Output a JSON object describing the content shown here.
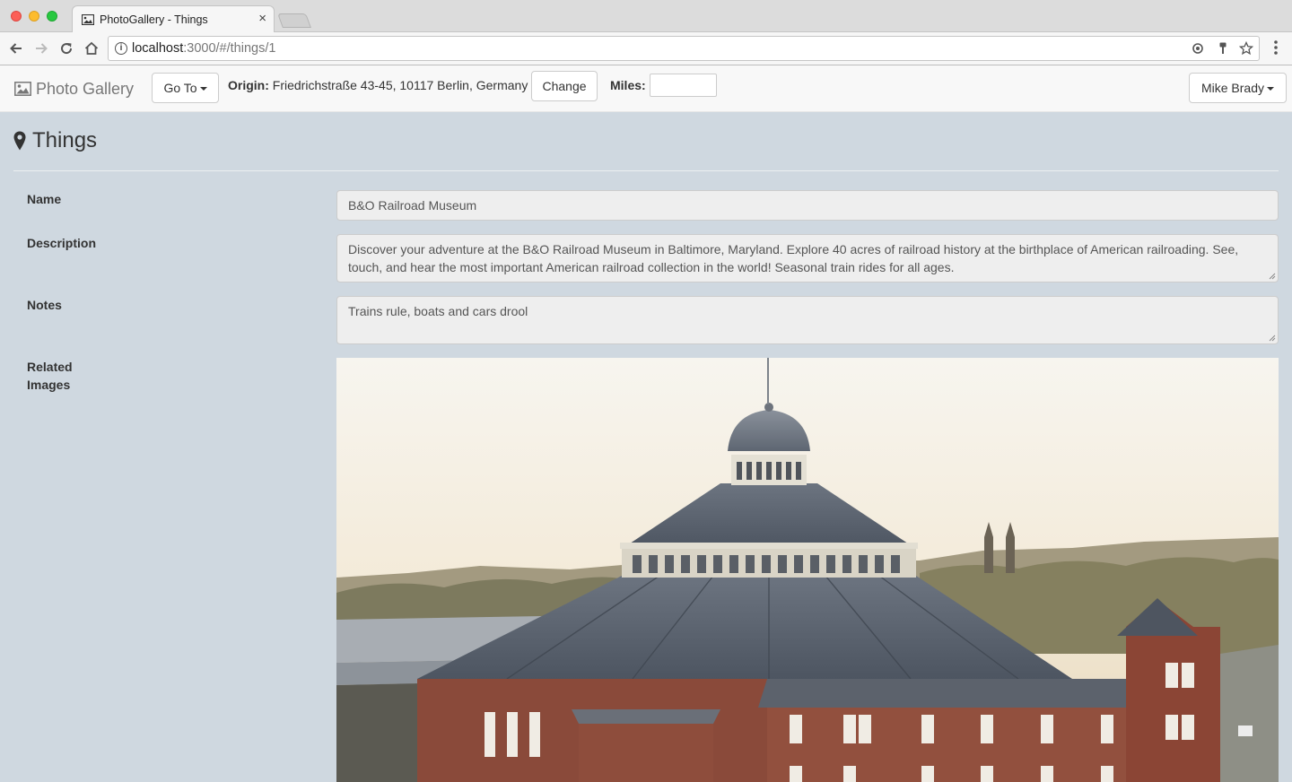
{
  "browser": {
    "tab_title": "PhotoGallery - Things",
    "tab_close": "×",
    "url_host": "localhost",
    "url_path": ":3000/#/things/1"
  },
  "navbar": {
    "brand": "Photo Gallery",
    "goto_label": "Go To",
    "origin_label": "Origin:",
    "origin_value": "Friedrichstraße 43-45, 10117 Berlin, Germany",
    "change_label": "Change",
    "miles_label": "Miles:",
    "miles_value": "",
    "user_label": "Mike Brady"
  },
  "page": {
    "title": "Things"
  },
  "form": {
    "name_label": "Name",
    "name_value": "B&O Railroad Museum",
    "description_label": "Description",
    "description_value": "Discover your adventure at the B&O Railroad Museum in Baltimore, Maryland. Explore 40 acres of railroad history at the birthplace of American railroading. See, touch, and hear the most important American railroad collection in the world! Seasonal train rides for all ages.",
    "notes_label": "Notes",
    "notes_value": "Trains rule, boats and cars drool",
    "related_label_line1": "Related",
    "related_label_line2": "Images"
  },
  "colors": {
    "page_bg": "#cfd8e0",
    "navbar_bg": "#f8f8f8",
    "field_bg": "#eeeeee"
  },
  "icons": {
    "tab_favicon": "image-icon",
    "brand": "picture-icon",
    "title": "map-marker-icon"
  }
}
